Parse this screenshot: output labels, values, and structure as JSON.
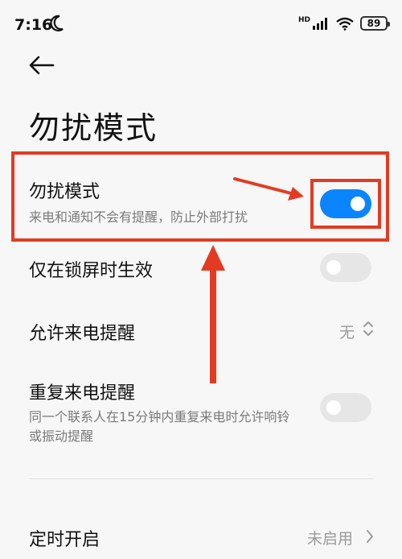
{
  "status_bar": {
    "time": "7:16",
    "network_label": "HD",
    "battery": "89"
  },
  "header": {
    "title": "勿扰模式"
  },
  "settings": {
    "dnd": {
      "title": "勿扰模式",
      "subtitle": "来电和通知不会有提醒，防止外部打扰",
      "enabled": true
    },
    "lock_screen_only": {
      "title": "仅在锁屏时生效",
      "enabled": false
    },
    "allow_calls": {
      "title": "允许来电提醒",
      "value": "无"
    },
    "repeat_calls": {
      "title": "重复来电提醒",
      "subtitle_line1": "同一个联系人在15分钟内重复来电时允许响铃",
      "subtitle_line2": "或振动提醒",
      "enabled": false
    },
    "schedule": {
      "title": "定时开启",
      "value": "未启用"
    }
  },
  "colors": {
    "accent": "#0a84ff",
    "annotation": "#e43a22",
    "background": "#f7f7f7"
  }
}
